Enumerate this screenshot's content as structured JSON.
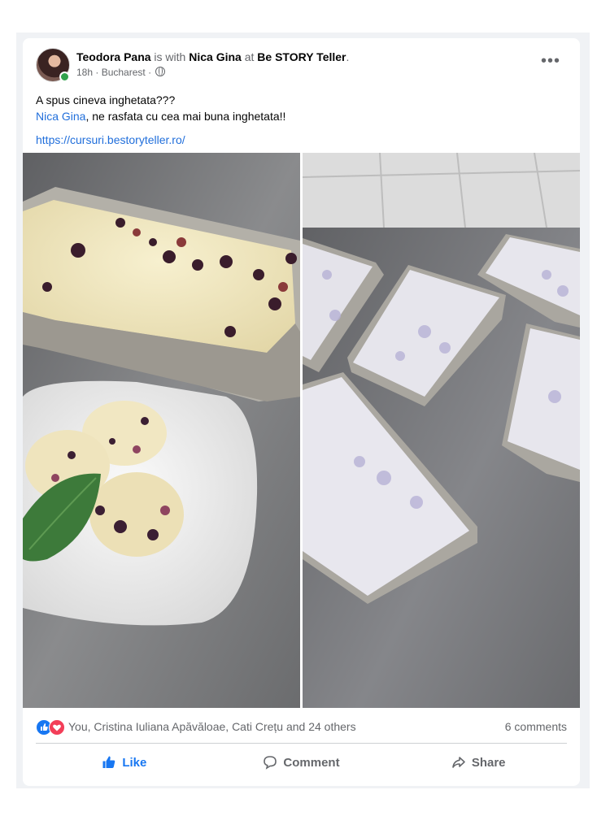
{
  "post": {
    "author": "Teodora Pana",
    "with_word": " is with ",
    "tagged_person": "Nica Gina",
    "at_word": " at ",
    "location_page": "Be STORY Teller",
    "period": ".",
    "time": "18h",
    "separator": " · ",
    "place": "Bucharest",
    "separator2": " · ",
    "more_label": "•••",
    "text_line1": "A spus cineva inghetata???",
    "text_tag": "Nica Gina",
    "text_line2_rest": ", ne rasfata cu cea mai buna inghetata!!",
    "link": "https://cursuri.bestoryteller.ro/"
  },
  "reactions": {
    "summary": "You, Cristina Iuliana Apăvăloae, Cati Crețu and 24 others",
    "comments": "6 comments"
  },
  "actions": {
    "like": "Like",
    "comment": "Comment",
    "share": "Share"
  },
  "colors": {
    "brand_blue": "#1877f2",
    "link_blue": "#216fdb",
    "love_red": "#f33e58",
    "secondary_text": "#65676b"
  }
}
